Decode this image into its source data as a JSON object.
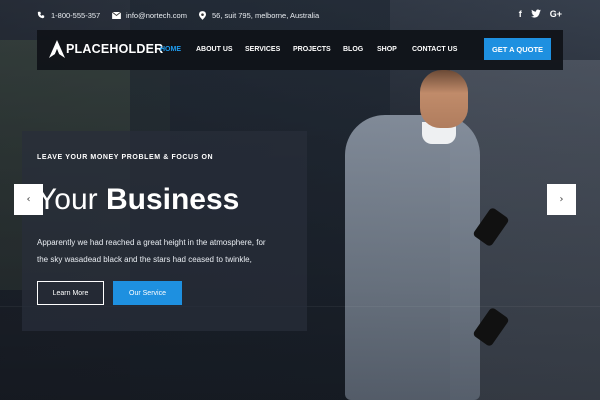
{
  "topbar": {
    "phone": "1-800-555-357",
    "email": "info@nortech.com",
    "address": "56, suit 795, melborne, Australia",
    "social": [
      "f",
      "t",
      "G+"
    ]
  },
  "nav": {
    "brand": "PLACEHOLDER",
    "items": [
      {
        "label": "HOME",
        "active": true
      },
      {
        "label": "ABOUT US"
      },
      {
        "label": "SERVICES"
      },
      {
        "label": "PROJECTS"
      },
      {
        "label": "BLOG"
      },
      {
        "label": "SHOP"
      },
      {
        "label": "CONTACT US"
      }
    ],
    "cta": "GET A QUOTE"
  },
  "hero": {
    "kicker": "LEAVE YOUR MONEY PROBLEM & FOCUS ON",
    "headline_light": "Your",
    "headline_bold": "Business",
    "paragraph_line1": "Apparently we had reached a great height in the atmosphere, for",
    "paragraph_line2": "the sky wasadead black and the stars had ceased to twinkle,",
    "btn_primary": "Learn More",
    "btn_secondary": "Our Service"
  },
  "slider": {
    "prev": "‹",
    "next": "›"
  },
  "colors": {
    "accent": "#1e90e0",
    "nav_bg": "#0f1218"
  },
  "icons": {
    "phone": "phone-icon",
    "email": "envelope-icon",
    "address": "map-marker-icon"
  }
}
